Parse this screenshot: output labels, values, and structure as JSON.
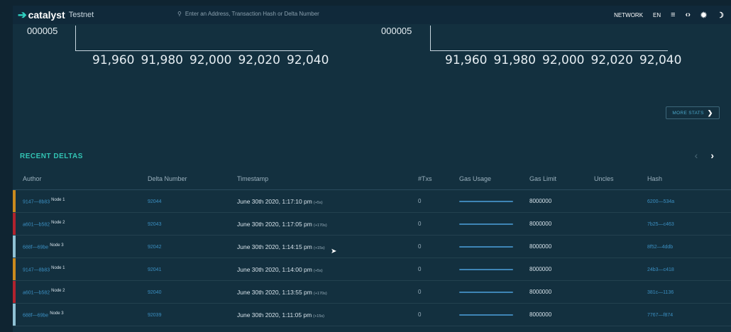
{
  "header": {
    "brand": "catalyst",
    "network_tag": "Testnet",
    "search_placeholder": "Enter an Address, Transaction Hash or Delta Number",
    "nav": {
      "network": "NETWORK",
      "language": "EN"
    }
  },
  "charts": [
    {
      "y_label_fragment": "000005",
      "x_ticks": [
        "91,960",
        "91,980",
        "92,000",
        "92,020",
        "92,040"
      ]
    },
    {
      "y_label_fragment": "000005",
      "x_ticks": [
        "91,960",
        "91,980",
        "92,000",
        "92,020",
        "92,040"
      ]
    }
  ],
  "more_stats_label": "MORE STATS",
  "recent_deltas": {
    "title": "RECENT DELTAS",
    "columns": [
      "Author",
      "Delta Number",
      "Timestamp",
      "#Txs",
      "Gas Usage",
      "Gas Limit",
      "Uncles",
      "Hash"
    ],
    "rows": [
      {
        "author": "9147—8b83",
        "node": "Node 1",
        "color": "#c98a1e",
        "delta": "92044",
        "timestamp": "June 30th 2020, 1:17:10 pm",
        "offset": "(+5s)",
        "txs": "0",
        "gas_limit": "8000000",
        "hash": "6200—534a"
      },
      {
        "author": "a601—b582",
        "node": "Node 2",
        "color": "#b0232e",
        "delta": "92043",
        "timestamp": "June 30th 2020, 1:17:05 pm",
        "offset": "(+170s)",
        "txs": "0",
        "gas_limit": "8000000",
        "hash": "7b25—c463"
      },
      {
        "author": "688f—69be",
        "node": "Node 3",
        "color": "#8fc1d4",
        "delta": "92042",
        "timestamp": "June 30th 2020, 1:14:15 pm",
        "offset": "(+15s)",
        "txs": "0",
        "gas_limit": "8000000",
        "hash": "8f52—4ddb"
      },
      {
        "author": "9147—8b83",
        "node": "Node 1",
        "color": "#c98a1e",
        "delta": "92041",
        "timestamp": "June 30th 2020, 1:14:00 pm",
        "offset": "(+5s)",
        "txs": "0",
        "gas_limit": "8000000",
        "hash": "24b3—c418"
      },
      {
        "author": "a601—b582",
        "node": "Node 2",
        "color": "#b0232e",
        "delta": "92040",
        "timestamp": "June 30th 2020, 1:13:55 pm",
        "offset": "(+170s)",
        "txs": "0",
        "gas_limit": "8000000",
        "hash": "381c—1136"
      },
      {
        "author": "688f—69be",
        "node": "Node 3",
        "color": "#8fc1d4",
        "delta": "92039",
        "timestamp": "June 30th 2020, 1:11:05 pm",
        "offset": "(+15s)",
        "txs": "0",
        "gas_limit": "8000000",
        "hash": "7767—f874"
      }
    ]
  }
}
